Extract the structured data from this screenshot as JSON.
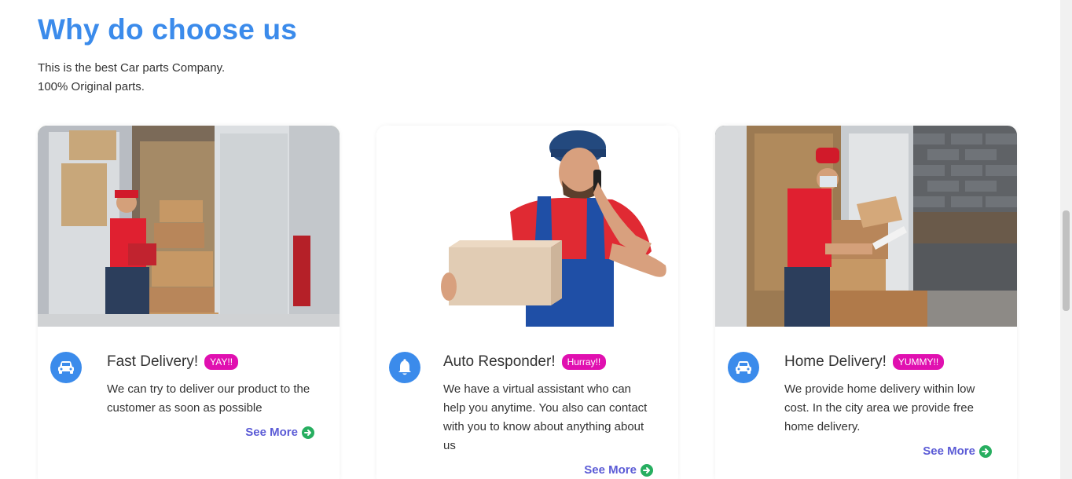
{
  "section": {
    "title": "Why do choose us",
    "subtitle_line1": "This is the best Car parts Company.",
    "subtitle_line2": "100% Original parts."
  },
  "cards": [
    {
      "icon": "car-icon",
      "image": "delivery-van-worker-photo",
      "heading": "Fast Delivery!",
      "badge": "YAY!!",
      "description": "We can try to deliver our product to the customer as soon as possible",
      "link_label": "See More"
    },
    {
      "icon": "bell-icon",
      "image": "worker-phone-box-photo",
      "heading": "Auto Responder!",
      "badge": "Hurray!!",
      "description": "We have a virtual assistant who can help you anytime. You also can contact with you to know about anything about us",
      "link_label": "See More"
    },
    {
      "icon": "car-icon",
      "image": "masked-worker-van-photo",
      "heading": "Home Delivery!",
      "badge": "YUMMY!!",
      "description": "We provide home delivery within low cost. In the city area we provide free home delivery.",
      "link_label": "See More"
    }
  ],
  "colors": {
    "accent": "#3b8beb",
    "badge": "#e010b0",
    "link": "#5b5bd6",
    "link_arrow": "#27ae60"
  }
}
